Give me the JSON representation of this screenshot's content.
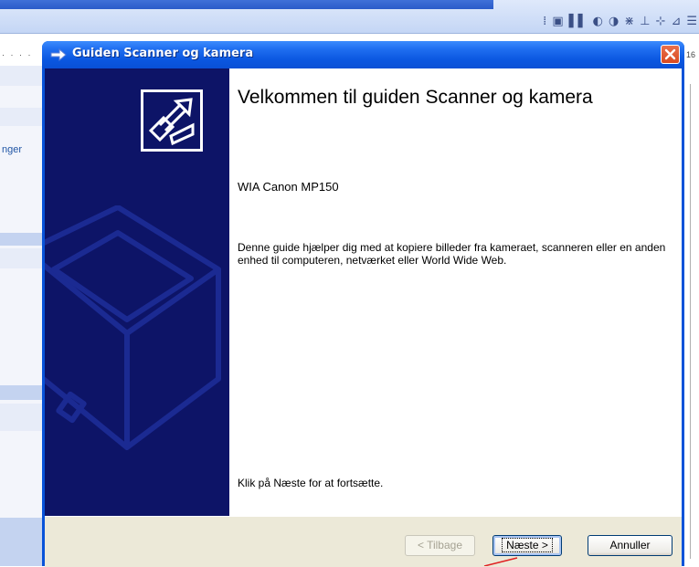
{
  "dialog": {
    "title": "Guiden Scanner og kamera",
    "heading": "Velkommen til guiden Scanner og kamera",
    "device_name": "WIA Canon MP150",
    "description": "Denne guide hjælper dig med at kopiere billeder fra kameraet, scanneren eller en anden enhed til computeren, netværket eller World Wide Web.",
    "footer_text": "Klik på Næste for at fortsætte.",
    "buttons": {
      "back": "< Tilbage",
      "next": "Næste >",
      "cancel": "Annuller"
    }
  },
  "background_app": {
    "left_panel_text": "nger",
    "ruler_number": "16"
  },
  "icons": {
    "title": "wizard-arrow-icon",
    "close": "close-icon",
    "wizard_logo": "scanner-camera-icon"
  },
  "colors": {
    "titlebar": "#0a56e0",
    "side_panel": "#0d1467",
    "button_bar": "#ece9d8",
    "close_button": "#e0582a",
    "annotation": "#e02020"
  }
}
